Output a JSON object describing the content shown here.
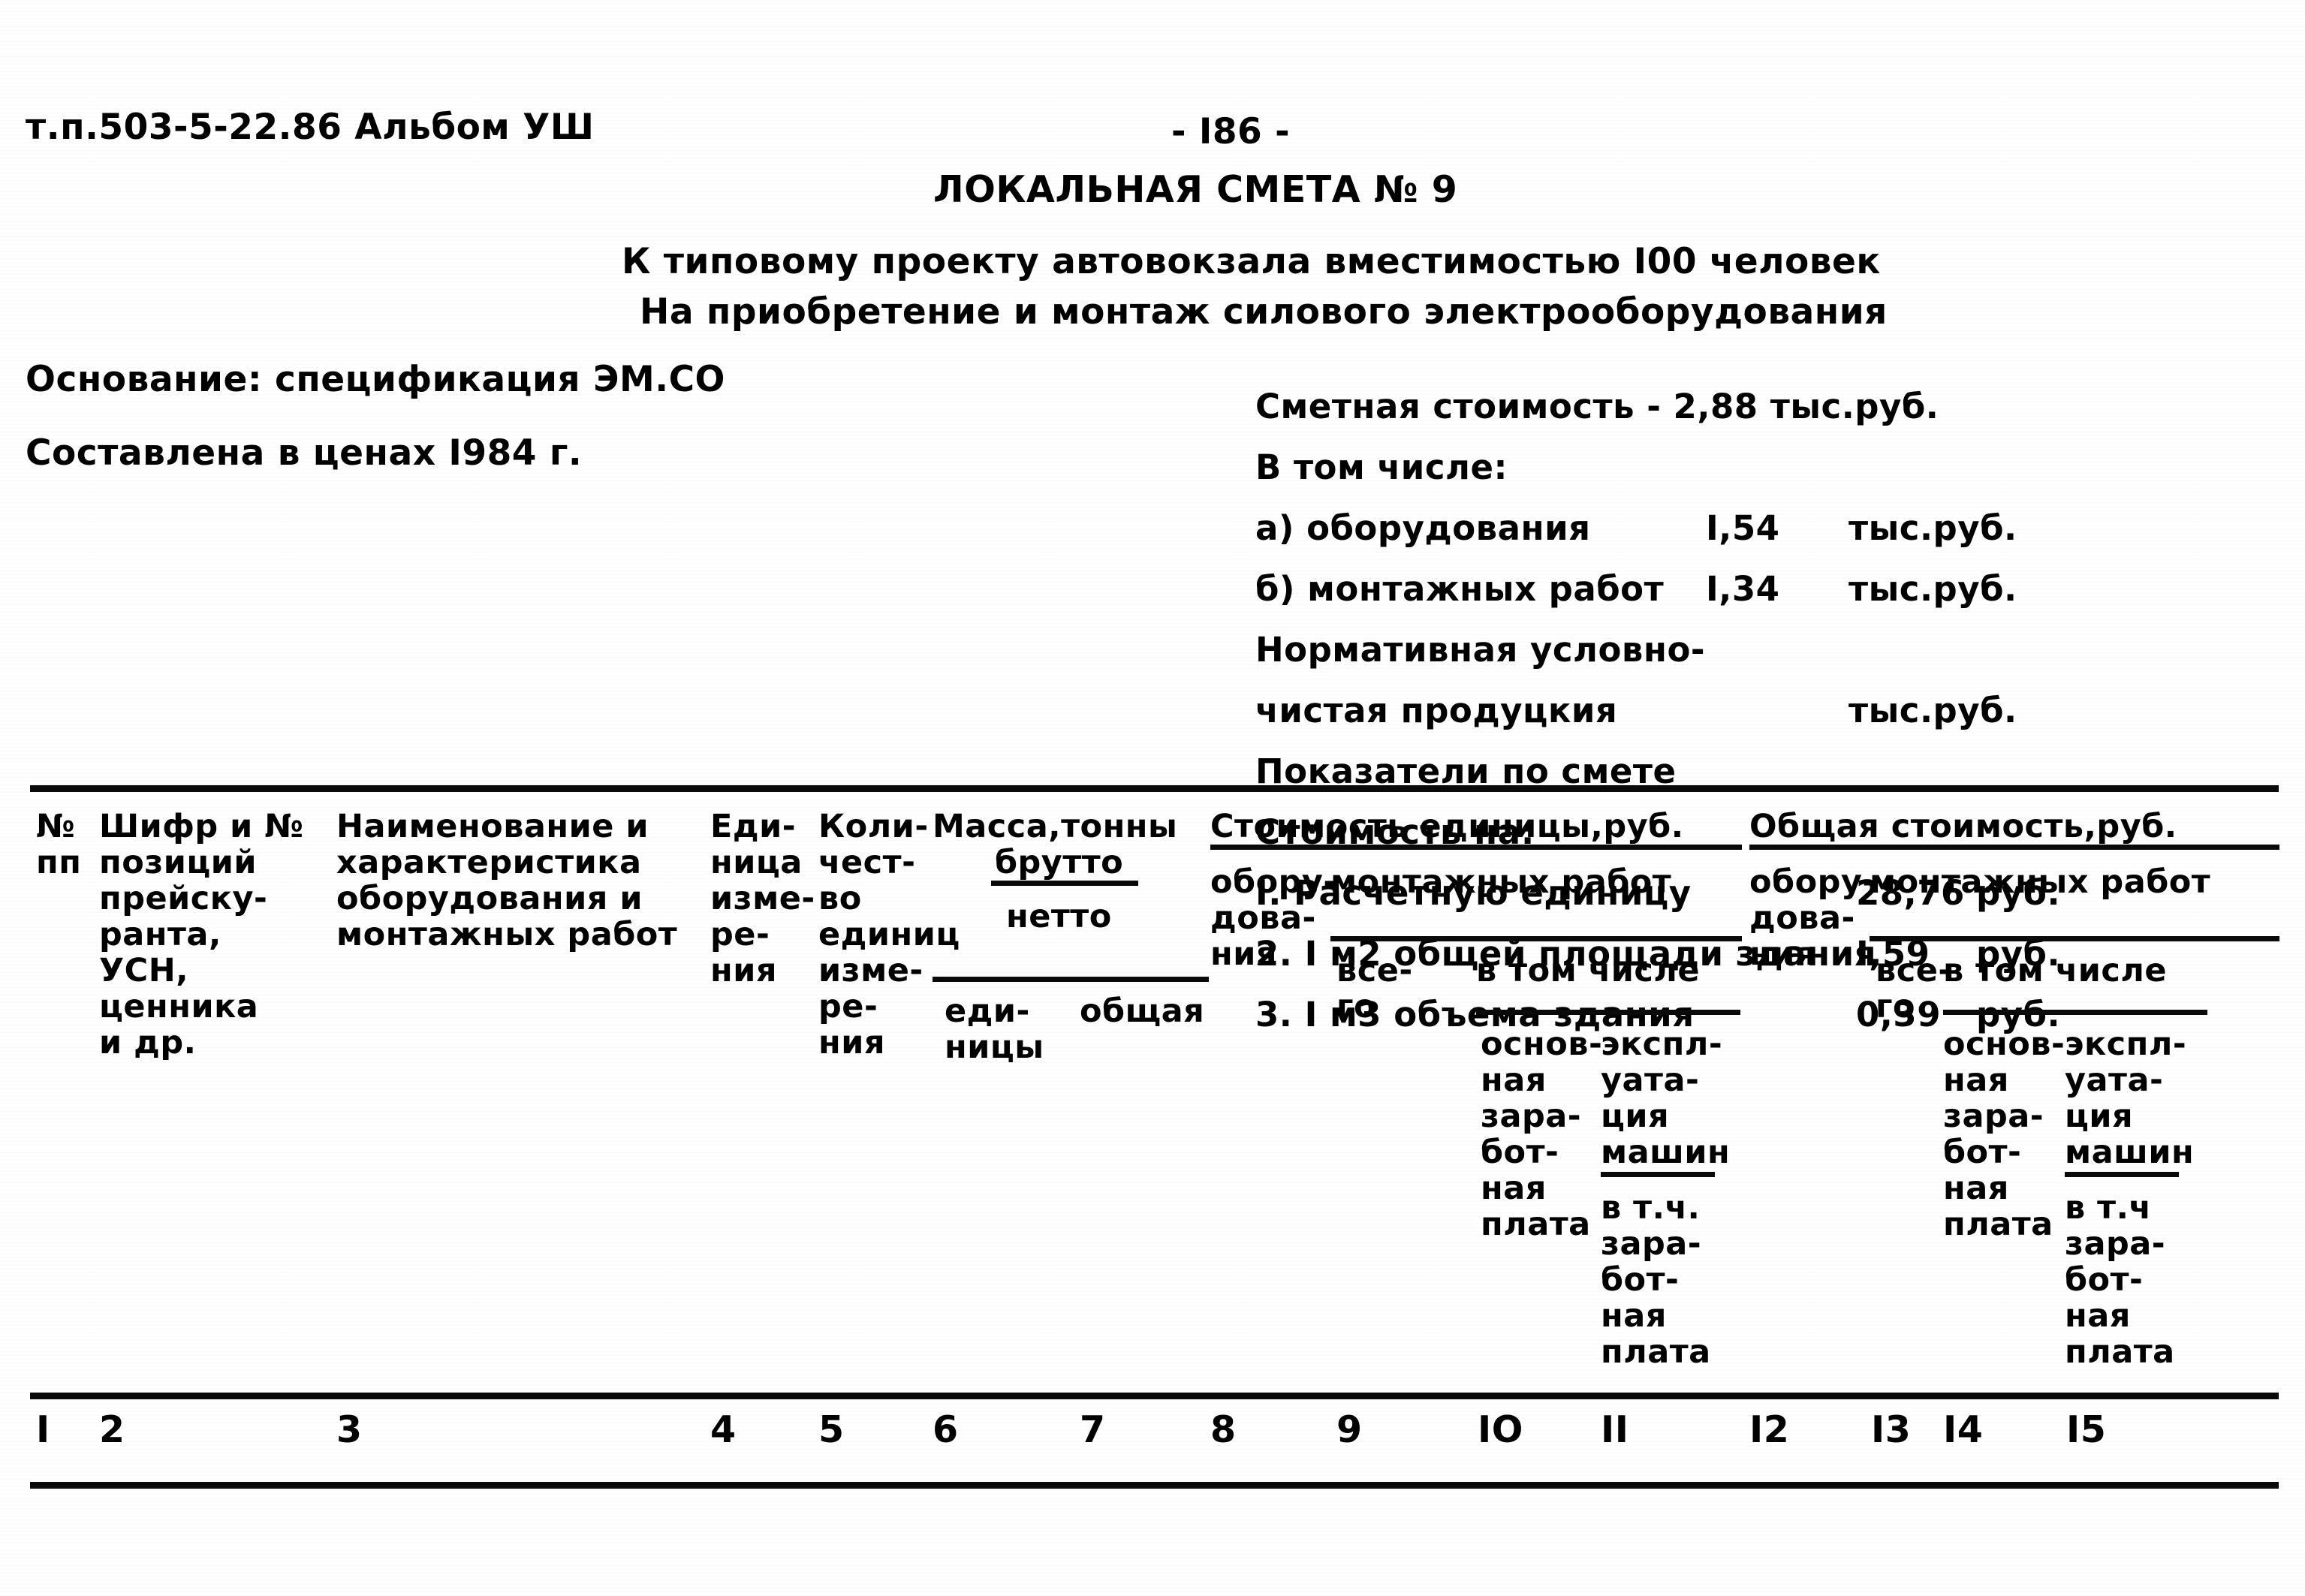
{
  "header": {
    "doc_code": "т.п.503-5-22.86 Альбом УШ",
    "page_number": "- I86 -",
    "title": "ЛОКАЛЬНАЯ СМЕТА № 9",
    "subtitle_1": "К типовому проекту автовокзала вместимостью I00 человек",
    "subtitle_2": "На приобретение и монтаж силового электрооборудования",
    "basis_label": "Основание: спецификация ЭМ.СО",
    "prices_label": "Составлена в ценах I984 г."
  },
  "summary": {
    "rows": [
      {
        "label": "Сметная стоимость - 2,88 тыс.руб.",
        "value": "",
        "unit": ""
      },
      {
        "label": "В том числе:",
        "value": "",
        "unit": ""
      },
      {
        "label": "а) оборудования",
        "value": "I,54",
        "unit": "тыс.руб."
      },
      {
        "label": "б) монтажных работ",
        "value": "I,34",
        "unit": "тыс.руб."
      },
      {
        "label": "Нормативная условно-",
        "value": "",
        "unit": ""
      },
      {
        "label": "чистая продуцкия",
        "value": "",
        "unit": "тыс.руб."
      },
      {
        "label": "Показатели по смете",
        "value": "",
        "unit": ""
      },
      {
        "label": "Стоимость на:",
        "value": "",
        "unit": ""
      },
      {
        "label": "I. Расчетную единицу",
        "value": "28,76",
        "unit": "руб."
      },
      {
        "label": "2. I м2 общей площади здания",
        "value": "I,59",
        "unit": "руб."
      },
      {
        "label": "3. I м3 объема здания",
        "value": "0,39",
        "unit": "руб."
      }
    ]
  },
  "table": {
    "headers": {
      "col1": "№\nпп",
      "col2": "Шифр и №\nпозиций\nпрейску-\nранта,\nУСН,\nценника\nи др.",
      "col3": "Наименование и\nхарактеристика\nоборудования и\nмонтажных работ",
      "col4": "Еди-\nница\nизме-\nре-\nния",
      "col5": "Коли-\nчест-\nво\nединиц\nизме-\nре-\nния",
      "mass_group": "Масса,тонны",
      "mass_brutto": "брутто",
      "mass_netto": "нетто",
      "mass_unit": "еди-\nницы",
      "mass_total": "общая",
      "unit_cost_group": "Стоимость единицы,руб.",
      "unit_cost_equipment": "обору-\nдова-\nния",
      "unit_cost_install": "монтажных работ",
      "unit_cost_total": "все-\nго",
      "unit_cost_incl": "в том числе",
      "unit_cost_basic_wage": "основ-\nная\nзара-\nбот-\nная\nплата",
      "unit_cost_machines": "экспл-\nуата-\nция\nмашин",
      "unit_cost_machines_wage": "в т.ч.\nзара-\nбот-\nная\nплата",
      "total_cost_group": "Общая стоимость,руб.",
      "total_cost_equipment": "обору-\nдова-\nния",
      "total_cost_install": "монтажных работ",
      "total_cost_total": "все-\nго",
      "total_cost_incl": "в том числе",
      "total_cost_basic_wage": "основ-\nная\nзара-\nбот-\nная\nплата",
      "total_cost_machines": "экспл-\nуата-\nция\nмашин",
      "total_cost_machines_wage": "в т.ч\nзара-\nбот-\nная\nплата"
    },
    "column_numbers": [
      "I",
      "2",
      "3",
      "4",
      "5",
      "6",
      "7",
      "8",
      "9",
      "IO",
      "II",
      "I2",
      "I3",
      "I4",
      "I5"
    ]
  }
}
